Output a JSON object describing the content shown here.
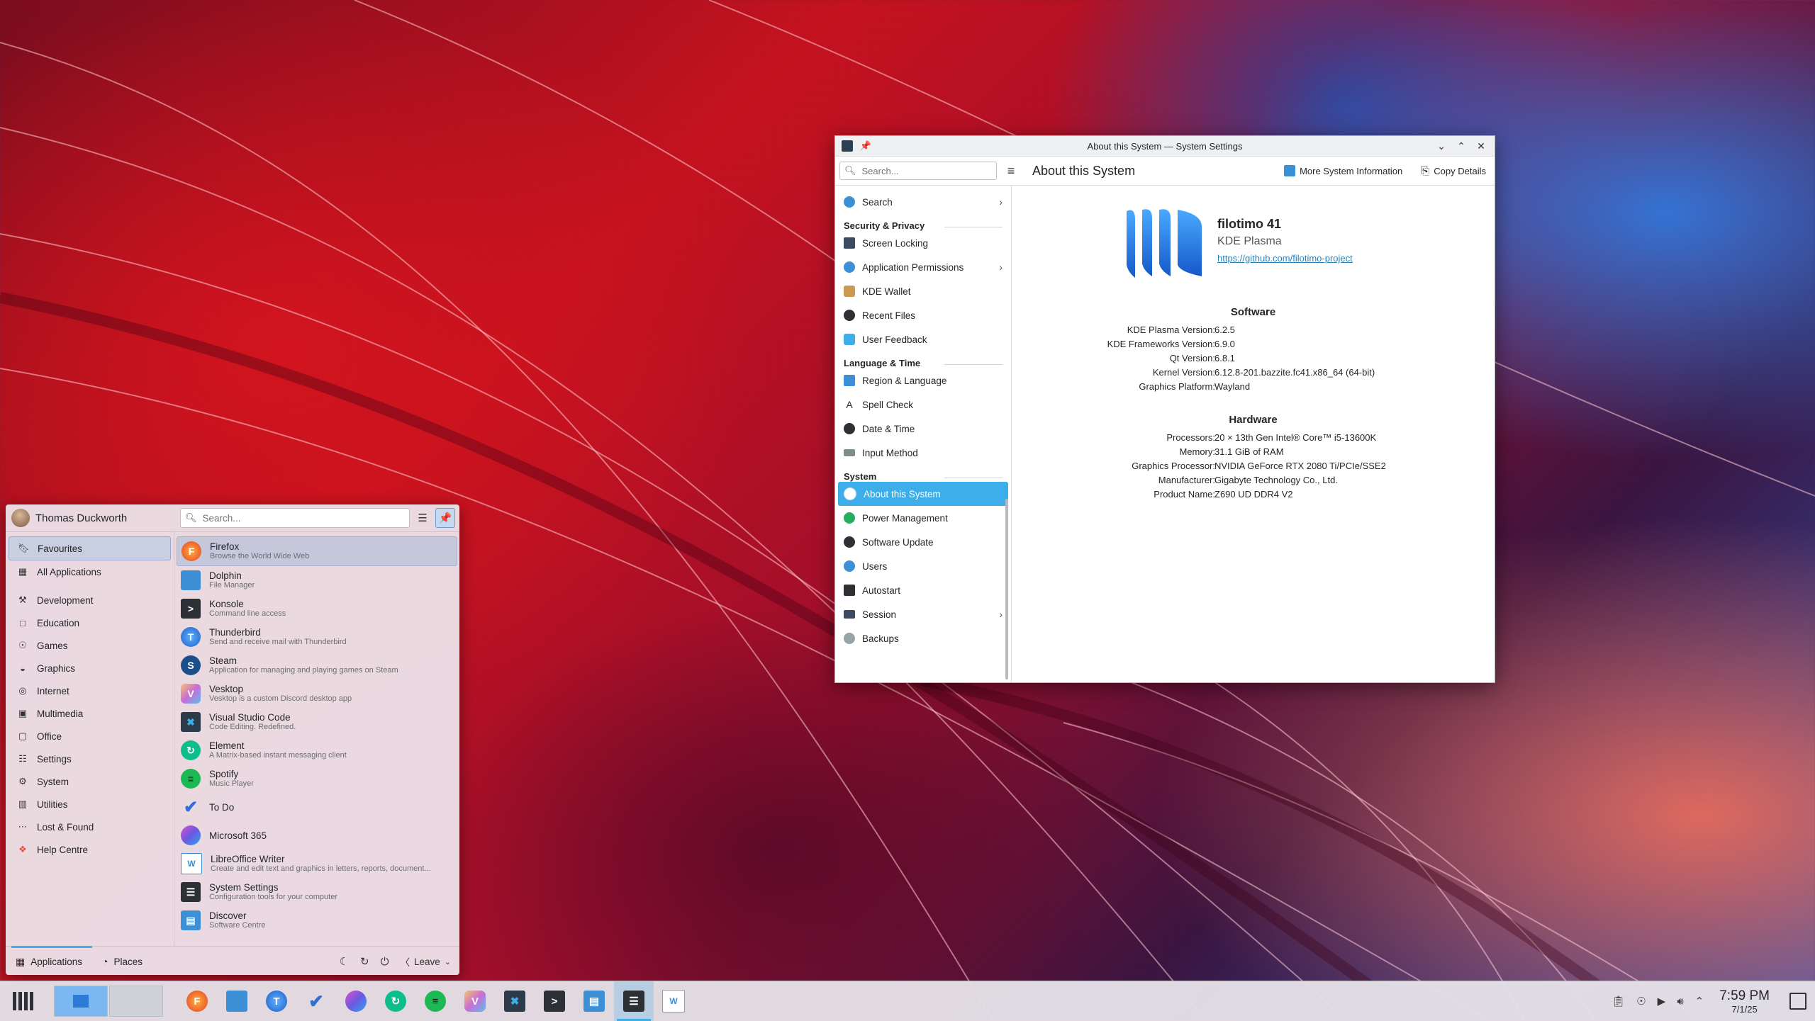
{
  "settings_window": {
    "title": "About this System — System Settings",
    "search_placeholder": "Search...",
    "page_title": "About this System",
    "more_info_label": "More System Information",
    "copy_details_label": "Copy Details",
    "sidebar": {
      "search_item": "Search",
      "cat_security": "Security & Privacy",
      "screen_locking": "Screen Locking",
      "app_permissions": "Application Permissions",
      "kde_wallet": "KDE Wallet",
      "recent_files": "Recent Files",
      "user_feedback": "User Feedback",
      "cat_language": "Language & Time",
      "region_language": "Region & Language",
      "spell_check": "Spell Check",
      "date_time": "Date & Time",
      "input_method": "Input Method",
      "cat_system": "System",
      "about_system": "About this System",
      "power_management": "Power Management",
      "software_update": "Software Update",
      "users": "Users",
      "autostart": "Autostart",
      "session": "Session",
      "backups": "Backups"
    },
    "distro": {
      "name": "filotimo 41",
      "desktop": "KDE Plasma",
      "url": "https://github.com/filotimo-project"
    },
    "software_heading": "Software",
    "software": [
      {
        "k": "KDE Plasma Version:",
        "v": "6.2.5"
      },
      {
        "k": "KDE Frameworks Version:",
        "v": "6.9.0"
      },
      {
        "k": "Qt Version:",
        "v": "6.8.1"
      },
      {
        "k": "Kernel Version:",
        "v": "6.12.8-201.bazzite.fc41.x86_64 (64-bit)"
      },
      {
        "k": "Graphics Platform:",
        "v": "Wayland"
      }
    ],
    "hardware_heading": "Hardware",
    "hardware": [
      {
        "k": "Processors:",
        "v": "20 × 13th Gen Intel® Core™ i5-13600K"
      },
      {
        "k": "Memory:",
        "v": "31.1 GiB of RAM"
      },
      {
        "k": "Graphics Processor:",
        "v": "NVIDIA GeForce RTX 2080 Ti/PCIe/SSE2"
      },
      {
        "k": "Manufacturer:",
        "v": "Gigabyte Technology Co., Ltd."
      },
      {
        "k": "Product Name:",
        "v": "Z690 UD DDR4 V2"
      }
    ]
  },
  "launcher": {
    "user_name": "Thomas Duckworth",
    "search_placeholder": "Search...",
    "categories": {
      "favourites": "Favourites",
      "all_apps": "All Applications",
      "development": "Development",
      "education": "Education",
      "games": "Games",
      "graphics": "Graphics",
      "internet": "Internet",
      "multimedia": "Multimedia",
      "office": "Office",
      "settings": "Settings",
      "system": "System",
      "utilities": "Utilities",
      "lost_found": "Lost & Found",
      "help": "Help Centre"
    },
    "apps": [
      {
        "name": "Firefox",
        "desc": "Browse the World Wide Web"
      },
      {
        "name": "Dolphin",
        "desc": "File Manager"
      },
      {
        "name": "Konsole",
        "desc": "Command line access"
      },
      {
        "name": "Thunderbird",
        "desc": "Send and receive mail with Thunderbird"
      },
      {
        "name": "Steam",
        "desc": "Application for managing and playing games on Steam"
      },
      {
        "name": "Vesktop",
        "desc": "Vesktop is a custom Discord desktop app"
      },
      {
        "name": "Visual Studio Code",
        "desc": "Code Editing. Redefined."
      },
      {
        "name": "Element",
        "desc": "A Matrix-based instant messaging client"
      },
      {
        "name": "Spotify",
        "desc": "Music Player"
      },
      {
        "name": "To Do",
        "desc": ""
      },
      {
        "name": "Microsoft 365",
        "desc": ""
      },
      {
        "name": "LibreOffice Writer",
        "desc": "Create and edit text and graphics in letters, reports, document..."
      },
      {
        "name": "System Settings",
        "desc": "Configuration tools for your computer"
      },
      {
        "name": "Discover",
        "desc": "Software Centre"
      }
    ],
    "footer": {
      "applications_tab": "Applications",
      "places_tab": "Places",
      "leave_label": "Leave"
    }
  },
  "taskbar": {
    "clock_time": "7:59 PM",
    "clock_date": "7/1/25"
  }
}
